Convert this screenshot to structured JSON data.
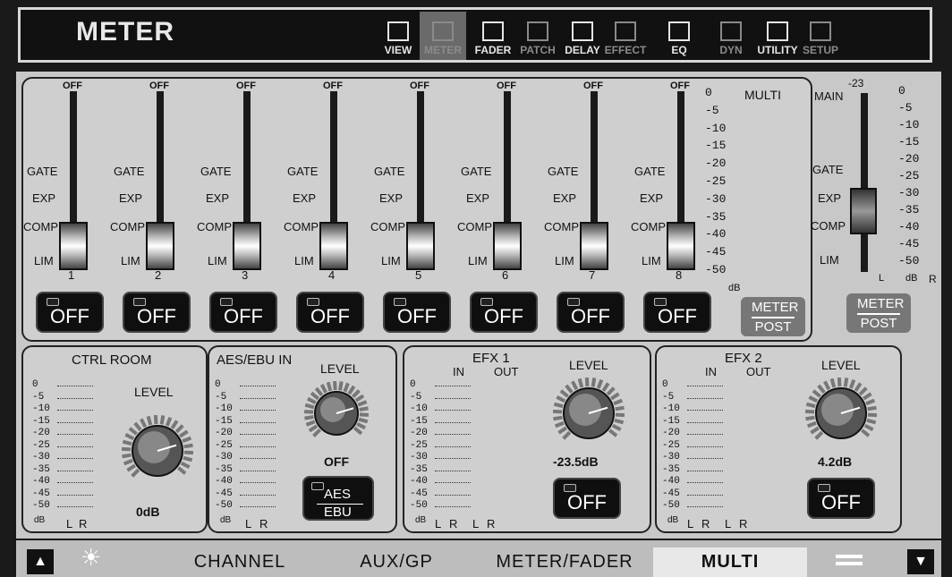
{
  "header": {
    "title": "METER",
    "nav": [
      {
        "id": "view",
        "label": "VIEW",
        "icon": "view-icon",
        "dim": false,
        "active": false
      },
      {
        "id": "meter",
        "label": "METER",
        "icon": "meter-icon",
        "dim": true,
        "active": true
      },
      {
        "id": "fader",
        "label": "FADER",
        "icon": "fader-icon",
        "dim": false,
        "active": false
      },
      {
        "id": "patch",
        "label": "PATCH",
        "icon": "patch-icon",
        "dim": true,
        "active": false
      },
      {
        "id": "delay",
        "label": "DELAY",
        "icon": "delay-icon",
        "dim": false,
        "active": false
      },
      {
        "id": "effect",
        "label": "EFFECT",
        "icon": "effect-icon",
        "dim": true,
        "active": false
      },
      {
        "id": "eq",
        "label": "EQ",
        "icon": "eq-icon",
        "dim": false,
        "active": false
      },
      {
        "id": "dyn",
        "label": "DYN",
        "icon": "dyn-icon",
        "dim": true,
        "active": false
      },
      {
        "id": "utility",
        "label": "UTILITY",
        "icon": "wrench-icon",
        "dim": false,
        "active": false
      },
      {
        "id": "setup",
        "label": "SETUP",
        "icon": "gear-icon",
        "dim": true,
        "active": false
      }
    ]
  },
  "multi": {
    "label": "MULTI",
    "channels": [
      {
        "num": "1",
        "top": "OFF",
        "off": "OFF"
      },
      {
        "num": "2",
        "top": "OFF",
        "off": "OFF"
      },
      {
        "num": "3",
        "top": "OFF",
        "off": "OFF"
      },
      {
        "num": "4",
        "top": "OFF",
        "off": "OFF"
      },
      {
        "num": "5",
        "top": "OFF",
        "off": "OFF"
      },
      {
        "num": "6",
        "top": "OFF",
        "off": "OFF"
      },
      {
        "num": "7",
        "top": "OFF",
        "off": "OFF"
      },
      {
        "num": "8",
        "top": "OFF",
        "off": "OFF"
      }
    ],
    "dyn_labels": {
      "gate": "GATE",
      "exp": "EXP",
      "comp": "COMP",
      "lim": "LIM"
    },
    "scale": [
      "0",
      "-5",
      "-10",
      "-15",
      "-20",
      "-25",
      "-30",
      "-35",
      "-40",
      "-45",
      "-50"
    ],
    "scale_unit": "dB",
    "meter_post": {
      "top": "METER",
      "bottom": "POST"
    }
  },
  "main_ch": {
    "label": "MAIN",
    "value": "-23",
    "dyn_labels": {
      "gate": "GATE",
      "exp": "EXP",
      "comp": "COMP",
      "lim": "LIM"
    },
    "scale": [
      "0",
      "-5",
      "-10",
      "-15",
      "-20",
      "-25",
      "-30",
      "-35",
      "-40",
      "-45",
      "-50"
    ],
    "unit": "dB",
    "l": "L",
    "r": "R",
    "meter_post": {
      "top": "METER",
      "bottom": "POST"
    }
  },
  "ctrl_room": {
    "title": "CTRL ROOM",
    "level_label": "LEVEL",
    "value": "0dB",
    "unit": "dB",
    "l": "L",
    "r": "R"
  },
  "aes": {
    "title": "AES/EBU IN",
    "level_label": "LEVEL",
    "value": "OFF",
    "btn_top": "AES",
    "btn_bottom": "EBU",
    "unit": "dB",
    "l": "L",
    "r": "R"
  },
  "efx1": {
    "title": "EFX 1",
    "in": "IN",
    "out": "OUT",
    "level_label": "LEVEL",
    "value": "-23.5dB",
    "off": "OFF",
    "unit": "dB",
    "l1": "L",
    "r1": "R",
    "l2": "L",
    "r2": "R"
  },
  "efx2": {
    "title": "EFX 2",
    "in": "IN",
    "out": "OUT",
    "level_label": "LEVEL",
    "value": "4.2dB",
    "off": "OFF",
    "unit": "dB",
    "l1": "L",
    "r1": "R",
    "l2": "L",
    "r2": "R"
  },
  "small_scale": [
    "0",
    "-5",
    "-10",
    "-15",
    "-20",
    "-25",
    "-30",
    "-35",
    "-40",
    "-45",
    "-50"
  ],
  "bottom": {
    "tabs": [
      {
        "label": "CHANNEL",
        "active": false
      },
      {
        "label": "AUX/GP",
        "active": false
      },
      {
        "label": "METER/FADER",
        "active": false
      },
      {
        "label": "MULTI",
        "active": true
      }
    ]
  }
}
